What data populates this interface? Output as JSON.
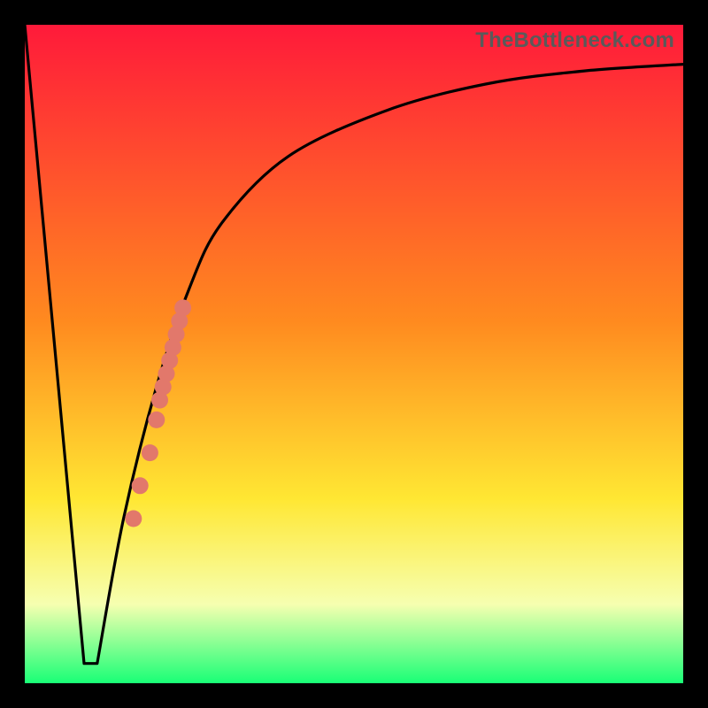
{
  "watermark": "TheBottleneck.com",
  "colors": {
    "frame": "#000000",
    "curve": "#000000",
    "dots": "#e2786b",
    "grad_top": "#ff1a3a",
    "grad_mid1": "#ff8a1f",
    "grad_mid2": "#ffe733",
    "grad_mid3": "#f6ffb0",
    "grad_bottom": "#19ff76"
  },
  "chart_data": {
    "type": "line",
    "title": "",
    "xlabel": "",
    "ylabel": "",
    "xlim": [
      0,
      100
    ],
    "ylim": [
      0,
      100
    ],
    "bottleneck_x": 10,
    "curve": [
      {
        "x": 0,
        "y": 100
      },
      {
        "x": 9,
        "y": 3
      },
      {
        "x": 10,
        "y": 3
      },
      {
        "x": 11,
        "y": 3
      },
      {
        "x": 15,
        "y": 25
      },
      {
        "x": 20,
        "y": 45
      },
      {
        "x": 25,
        "y": 60
      },
      {
        "x": 30,
        "y": 70
      },
      {
        "x": 40,
        "y": 80
      },
      {
        "x": 55,
        "y": 87
      },
      {
        "x": 70,
        "y": 91
      },
      {
        "x": 85,
        "y": 93
      },
      {
        "x": 100,
        "y": 94
      }
    ],
    "dots": [
      {
        "x": 16.5,
        "y": 25
      },
      {
        "x": 17.5,
        "y": 30
      },
      {
        "x": 19.0,
        "y": 35
      },
      {
        "x": 20.0,
        "y": 40
      },
      {
        "x": 20.5,
        "y": 43
      },
      {
        "x": 21.0,
        "y": 45
      },
      {
        "x": 21.5,
        "y": 47
      },
      {
        "x": 22.0,
        "y": 49
      },
      {
        "x": 22.5,
        "y": 51
      },
      {
        "x": 23.0,
        "y": 53
      },
      {
        "x": 23.5,
        "y": 55
      },
      {
        "x": 24.0,
        "y": 57
      }
    ]
  }
}
